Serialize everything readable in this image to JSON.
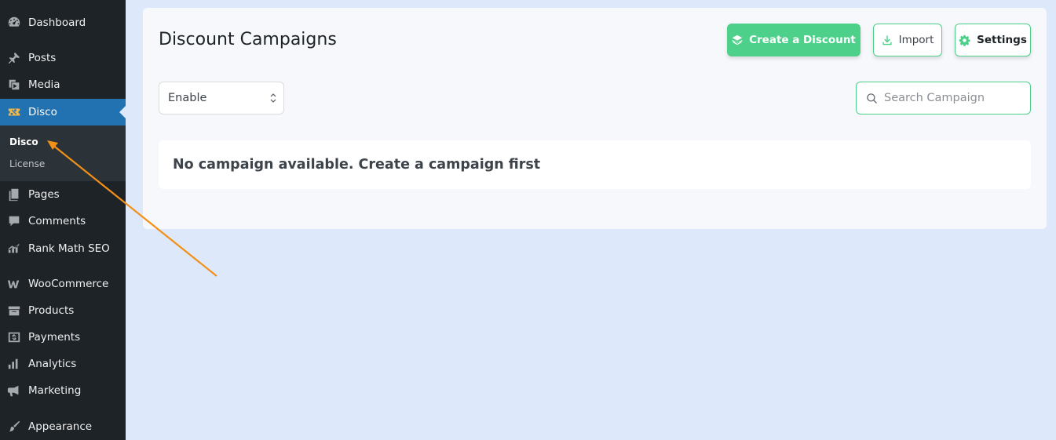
{
  "sidebar": {
    "items": [
      {
        "label": "Dashboard",
        "icon": "dashboard-icon"
      },
      {
        "label": "Posts",
        "icon": "pushpin-icon"
      },
      {
        "label": "Media",
        "icon": "media-icon"
      },
      {
        "label": "Disco",
        "icon": "disco-icon",
        "active": true
      },
      {
        "label": "Pages",
        "icon": "pages-icon"
      },
      {
        "label": "Comments",
        "icon": "comment-icon"
      },
      {
        "label": "Rank Math SEO",
        "icon": "rank-math-icon"
      },
      {
        "label": "WooCommerce",
        "icon": "woocommerce-icon"
      },
      {
        "label": "Products",
        "icon": "products-icon"
      },
      {
        "label": "Payments",
        "icon": "payments-icon"
      },
      {
        "label": "Analytics",
        "icon": "analytics-icon"
      },
      {
        "label": "Marketing",
        "icon": "megaphone-icon"
      },
      {
        "label": "Appearance",
        "icon": "paintbrush-icon"
      }
    ],
    "submenu": [
      {
        "label": "Disco",
        "current": true
      },
      {
        "label": "License"
      }
    ]
  },
  "main": {
    "title": "Discount Campaigns",
    "buttons": {
      "create": "Create a Discount",
      "import": "Import",
      "settings": "Settings"
    },
    "filter": {
      "selected": "Enable"
    },
    "search": {
      "placeholder": "Search Campaign"
    },
    "empty_message": "No campaign available. Create a campaign first"
  },
  "colors": {
    "accent": "#4cd08a",
    "sidebar_bg": "#1d2327",
    "active_bg": "#2271b1",
    "annotation_arrow": "#f39018"
  }
}
